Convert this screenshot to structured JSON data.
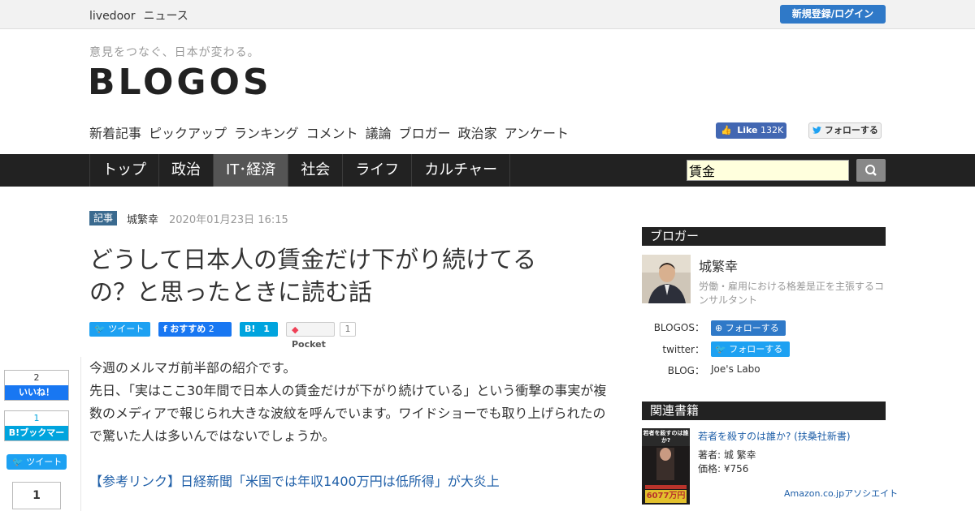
{
  "topbar": {
    "brand": "livedoor",
    "brand_sub": "ニュース",
    "login_label": "新規登録/ログイン"
  },
  "header": {
    "tagline": "意見をつなぐ、日本が変わる。",
    "logo": "BLOGOS",
    "subnav": [
      "新着記事",
      "ピックアップ",
      "ランキング",
      "コメント",
      "議論",
      "ブロガー",
      "政治家",
      "アンケート"
    ],
    "fb_like_label": "Like",
    "fb_like_count": "132K",
    "twitter_follow_label": "フォローする"
  },
  "mainnav": {
    "tabs": [
      "トップ",
      "政治",
      "IT･経済",
      "社会",
      "ライフ",
      "カルチャー"
    ],
    "active_index": 2
  },
  "search": {
    "value": "賃金",
    "icon": "search-icon"
  },
  "article": {
    "badge": "記事",
    "author": "城繁幸",
    "date": "2020年01月23日 16:15",
    "title": "どうして日本人の賃金だけ下がり続けてるの？と思ったときに読む話",
    "share": {
      "tweet": "ツイート",
      "fb_recommend": "おすすめ",
      "fb_count": "2",
      "hatena_label": "B!",
      "hatena_count": "1",
      "pocket_label": "Pocket",
      "pocket_count": "1"
    },
    "paragraphs": [
      "今週のメルマガ前半部の紹介です。",
      "先日、「実はここ30年間で日本人の賃金だけが下がり続けている」という衝撃の事実が複数のメディアで報じられ大きな波紋を呼んでいます。ワイドショーでも取り上げられたので驚いた人は多いんではないでしょうか。"
    ],
    "reference_link": "【参考リンク】日経新聞「米国では年収1400万円は低所得」が大炎上"
  },
  "floating_share": {
    "like_count": "2",
    "like_label": "いいね！",
    "bookmark_count": "1",
    "bookmark_label": "B!ブックマーク",
    "tweet_label": "ツイート",
    "pocket_count": "1"
  },
  "sidebar": {
    "blogger_heading": "ブロガー",
    "blogger_name": "城繁幸",
    "blogger_desc": "労働・雇用における格差是正を主張するコンサルタント",
    "blogos_label": "BLOGOS：",
    "blogos_follow": "フォローする",
    "twitter_label": "twitter：",
    "twitter_follow": "フォローする",
    "blog_label": "BLOG：",
    "blog_name": "Joe's Labo",
    "books_heading": "関連書籍",
    "book_title": "若者を殺すのは誰か? (扶桑社新書)",
    "book_author": "著者: 城 繁幸",
    "book_price": "価格: ¥756",
    "book_cover_title": "若者を殺すのは誰か?",
    "book_cover_figure": "6077万円",
    "amazon_label": "Amazon.co.jpアソシエイト"
  },
  "colors": {
    "brand_blue": "#2f79c8",
    "twitter": "#1da1f2",
    "facebook": "#1877f2",
    "hatena": "#00a4de",
    "nav_bg": "#222222"
  }
}
